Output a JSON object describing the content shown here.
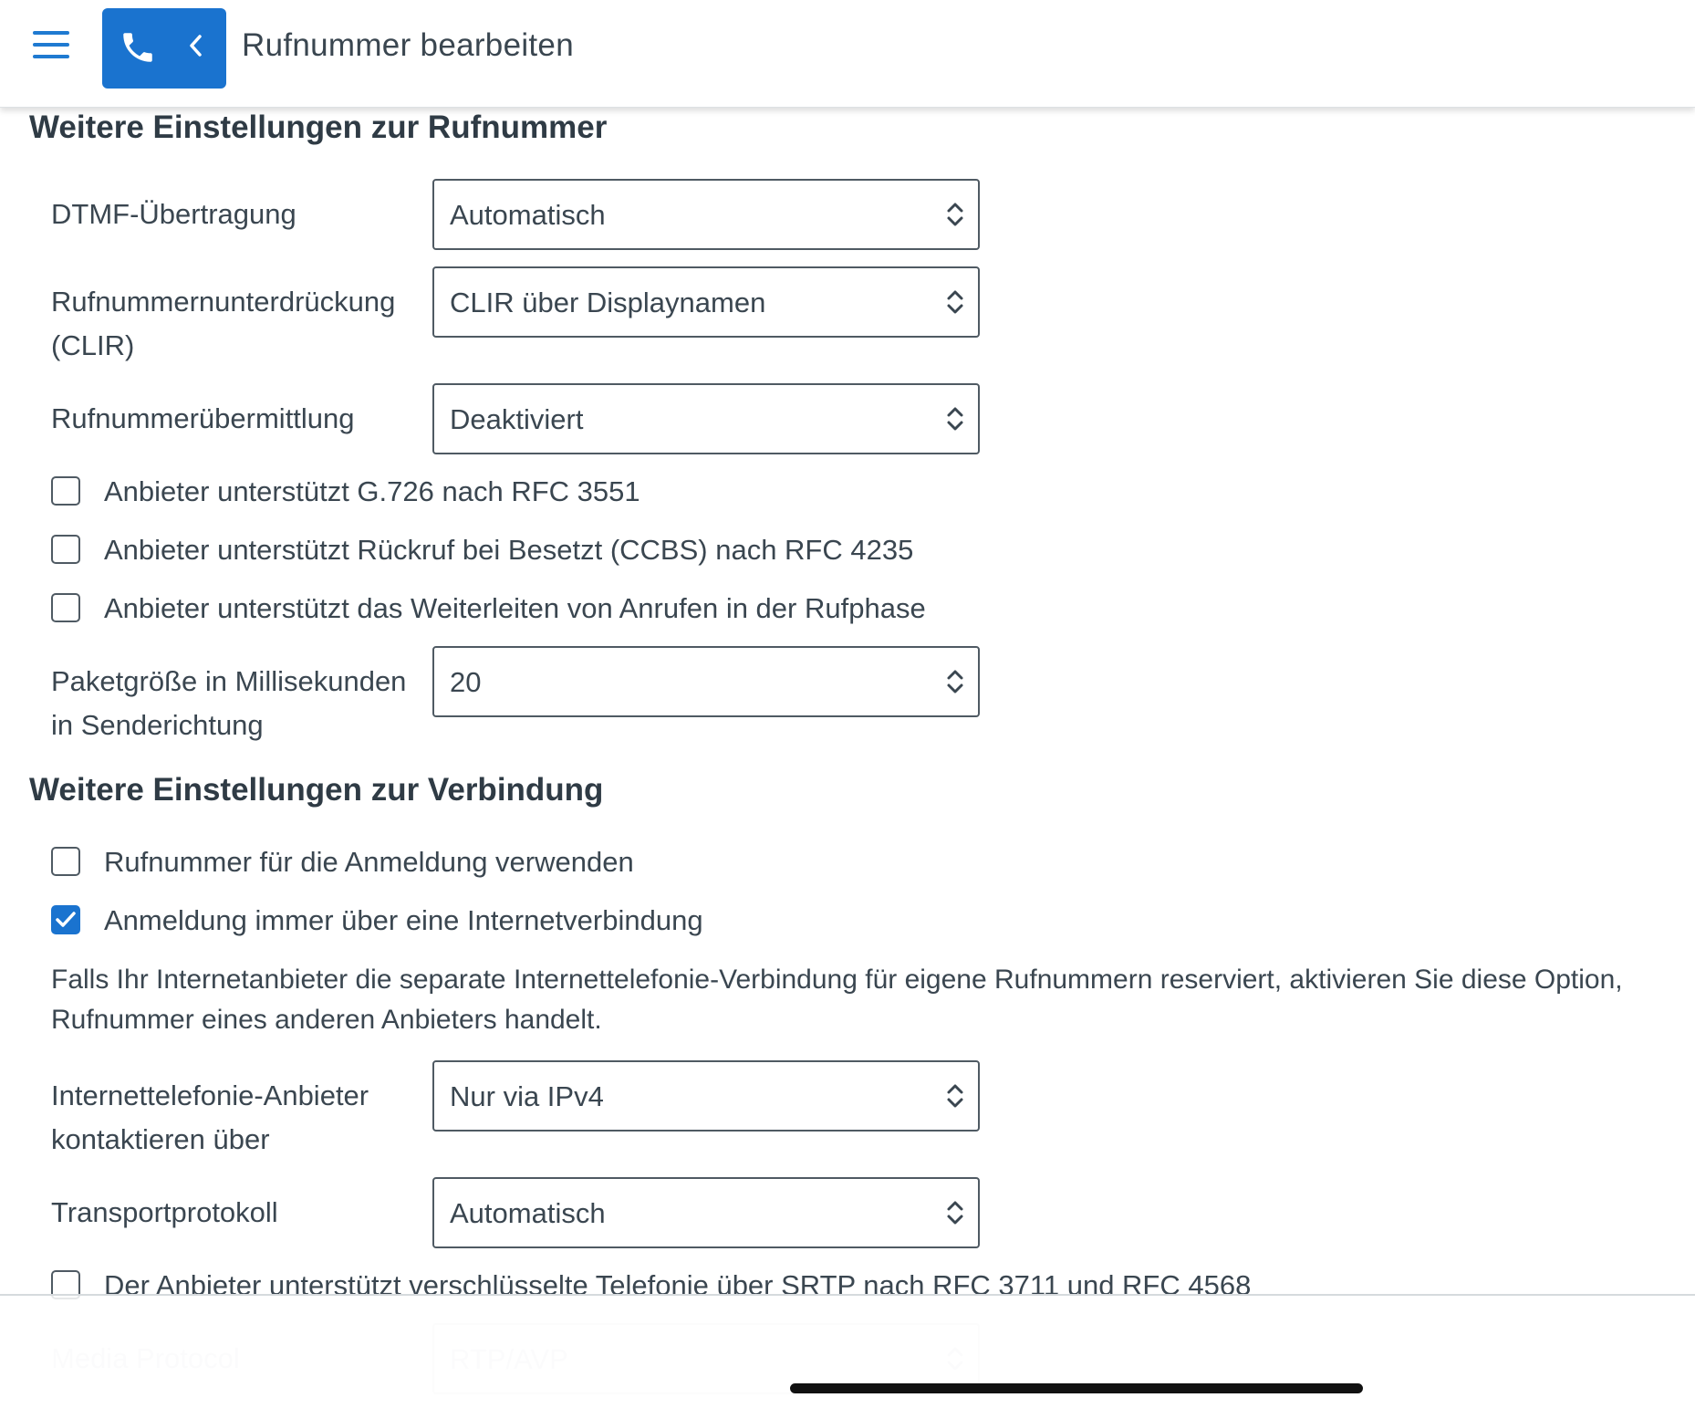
{
  "header": {
    "title": "Rufnummer bearbeiten",
    "menu_icon": "hamburger-menu-icon",
    "phone_icon": "phone-icon",
    "back_icon": "chevron-left-icon",
    "accent_color": "#1a73cf"
  },
  "section_number": {
    "heading": "Weitere Einstellungen zur Rufnummer",
    "dtmf": {
      "label": "DTMF-Übertragung",
      "value": "Automatisch"
    },
    "clir": {
      "label": "Rufnummernunterdrückung (CLIR)",
      "value": "CLIR über Displaynamen"
    },
    "clip": {
      "label": "Rufnummerübermittlung",
      "value": "Deaktiviert"
    },
    "checkboxes": [
      {
        "label": "Anbieter unterstützt G.726 nach RFC 3551",
        "checked": false
      },
      {
        "label": "Anbieter unterstützt Rückruf bei Besetzt (CCBS) nach RFC 4235",
        "checked": false
      },
      {
        "label": "Anbieter unterstützt das Weiterleiten von Anrufen in der Rufphase",
        "checked": false
      }
    ],
    "packet_size": {
      "label": "Paketgröße in Millisekunden in Senderichtung",
      "value": "20"
    }
  },
  "section_connection": {
    "heading": "Weitere Einstellungen zur Verbindung",
    "checkboxes": [
      {
        "label": "Rufnummer für die Anmeldung verwenden",
        "checked": false
      },
      {
        "label": "Anmeldung immer über eine Internetverbindung",
        "checked": true
      }
    ],
    "info_line1": "Falls Ihr Internetanbieter die separate Internettelefonie-Verbindung für eigene Rufnummern reserviert, aktivieren Sie diese Option,",
    "info_line2": "Rufnummer eines anderen Anbieters handelt.",
    "ip_version": {
      "label": "Internettelefonie-Anbieter kontaktieren über",
      "value": "Nur via IPv4"
    },
    "transport": {
      "label": "Transportprotokoll",
      "value": "Automatisch"
    },
    "srtp": {
      "label": "Der Anbieter unterstützt verschlüsselte Telefonie über SRTP nach RFC 3711 und RFC 4568",
      "checked": false
    },
    "media_protocol": {
      "label": "Media Protocol",
      "value": "RTP/AVP"
    }
  }
}
